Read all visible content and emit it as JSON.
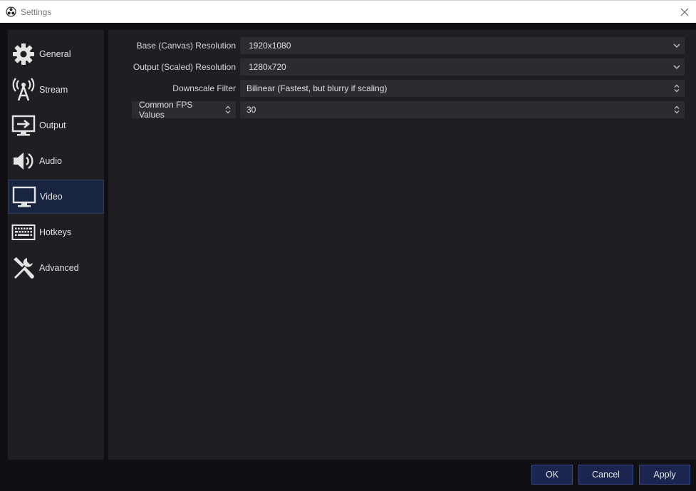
{
  "window": {
    "title": "Settings"
  },
  "sidebar": {
    "items": [
      {
        "label": "General",
        "icon": "gear-icon"
      },
      {
        "label": "Stream",
        "icon": "broadcast-tower-icon"
      },
      {
        "label": "Output",
        "icon": "output-monitor-icon"
      },
      {
        "label": "Audio",
        "icon": "speaker-icon"
      },
      {
        "label": "Video",
        "icon": "monitor-icon",
        "active": true
      },
      {
        "label": "Hotkeys",
        "icon": "keyboard-icon"
      },
      {
        "label": "Advanced",
        "icon": "tools-icon"
      }
    ]
  },
  "video": {
    "base_resolution": {
      "label": "Base (Canvas) Resolution",
      "value": "1920x1080"
    },
    "output_resolution": {
      "label": "Output (Scaled) Resolution",
      "value": "1280x720"
    },
    "downscale_filter": {
      "label": "Downscale Filter",
      "value": "Bilinear (Fastest, but blurry if scaling)"
    },
    "fps": {
      "type_label": "Common FPS Values",
      "value": "30"
    }
  },
  "footer": {
    "ok": "OK",
    "cancel": "Cancel",
    "apply": "Apply"
  },
  "colors": {
    "accent": "#1b2550",
    "accent_border": "#3a4a86",
    "active_nav": "#192540",
    "panel": "#1e1e23",
    "field": "#2b2b31"
  }
}
